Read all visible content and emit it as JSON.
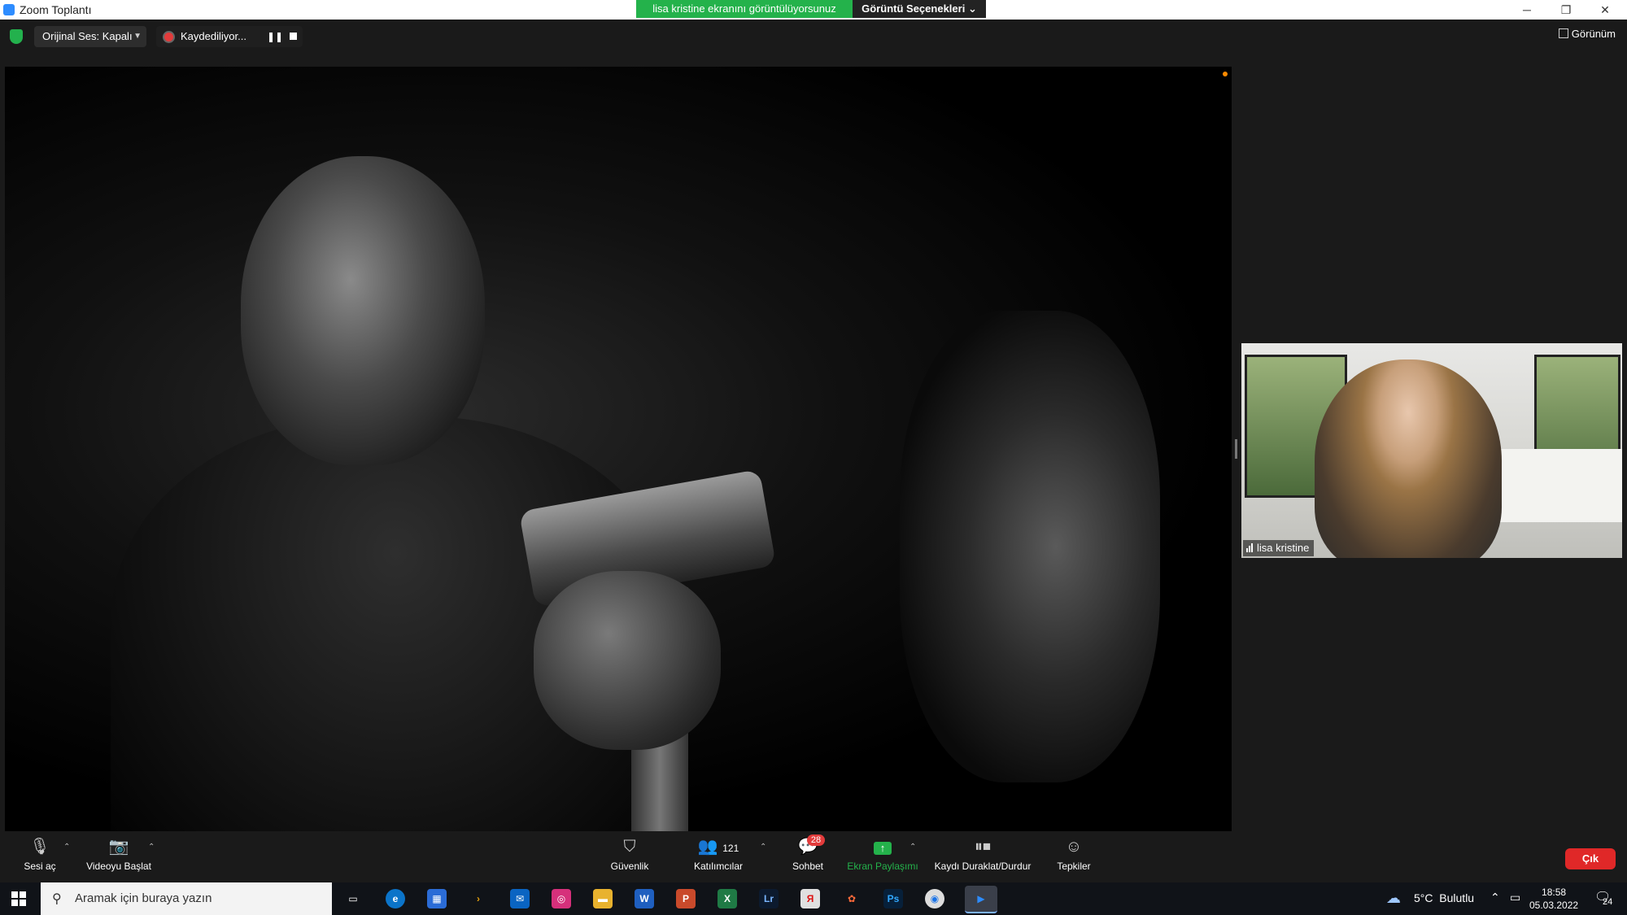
{
  "window": {
    "title": "Zoom Toplantı",
    "share_banner": "lisa kristine ekranını görüntülüyorsunuz",
    "view_options": "Görüntü Seçenekleri",
    "controls": {
      "minimize": "─",
      "restore": "❐",
      "close": "✕"
    }
  },
  "topbar": {
    "audio_label": "Orijinal Ses: Kapalı",
    "recording_label": "Kaydediliyor...",
    "view_label": "Görünüm"
  },
  "participant": {
    "name": "lisa kristine"
  },
  "toolbar": {
    "unmute": "Sesi aç",
    "start_video": "Videoyu Başlat",
    "security": "Güvenlik",
    "participants": "Katılımcılar",
    "participants_count": "121",
    "chat": "Sohbet",
    "chat_badge": "28",
    "share_screen": "Ekran Paylaşımı",
    "recording_control": "Kaydı Duraklat/Durdur",
    "reactions": "Tepkiler",
    "leave": "Çık",
    "share_color": "#24b24b",
    "leave_color": "#e02828"
  },
  "taskbar": {
    "search_placeholder": "Aramak için buraya yazın",
    "apps": [
      {
        "name": "task-view-icon",
        "label": "▭"
      },
      {
        "name": "edge-icon",
        "label": "e"
      },
      {
        "name": "store-icon",
        "label": "▦"
      },
      {
        "name": "plex-icon",
        "label": "›"
      },
      {
        "name": "mail-icon",
        "label": "✉"
      },
      {
        "name": "instagram-icon",
        "label": "◎"
      },
      {
        "name": "file-explorer-icon",
        "label": "▬"
      },
      {
        "name": "word-icon",
        "label": "W"
      },
      {
        "name": "powerpoint-icon",
        "label": "P"
      },
      {
        "name": "excel-icon",
        "label": "X"
      },
      {
        "name": "lightroom-icon",
        "label": "Lr"
      },
      {
        "name": "yandex-icon",
        "label": "Я"
      },
      {
        "name": "gnome-app-icon",
        "label": "✿"
      },
      {
        "name": "photoshop-icon",
        "label": "Ps"
      },
      {
        "name": "chrome-icon",
        "label": "◉"
      },
      {
        "name": "zoom-icon",
        "label": "▶"
      }
    ],
    "temperature": "5°C",
    "weather": "Bulutlu",
    "time": "18:58",
    "date": "05.03.2022",
    "notifications": "24"
  }
}
